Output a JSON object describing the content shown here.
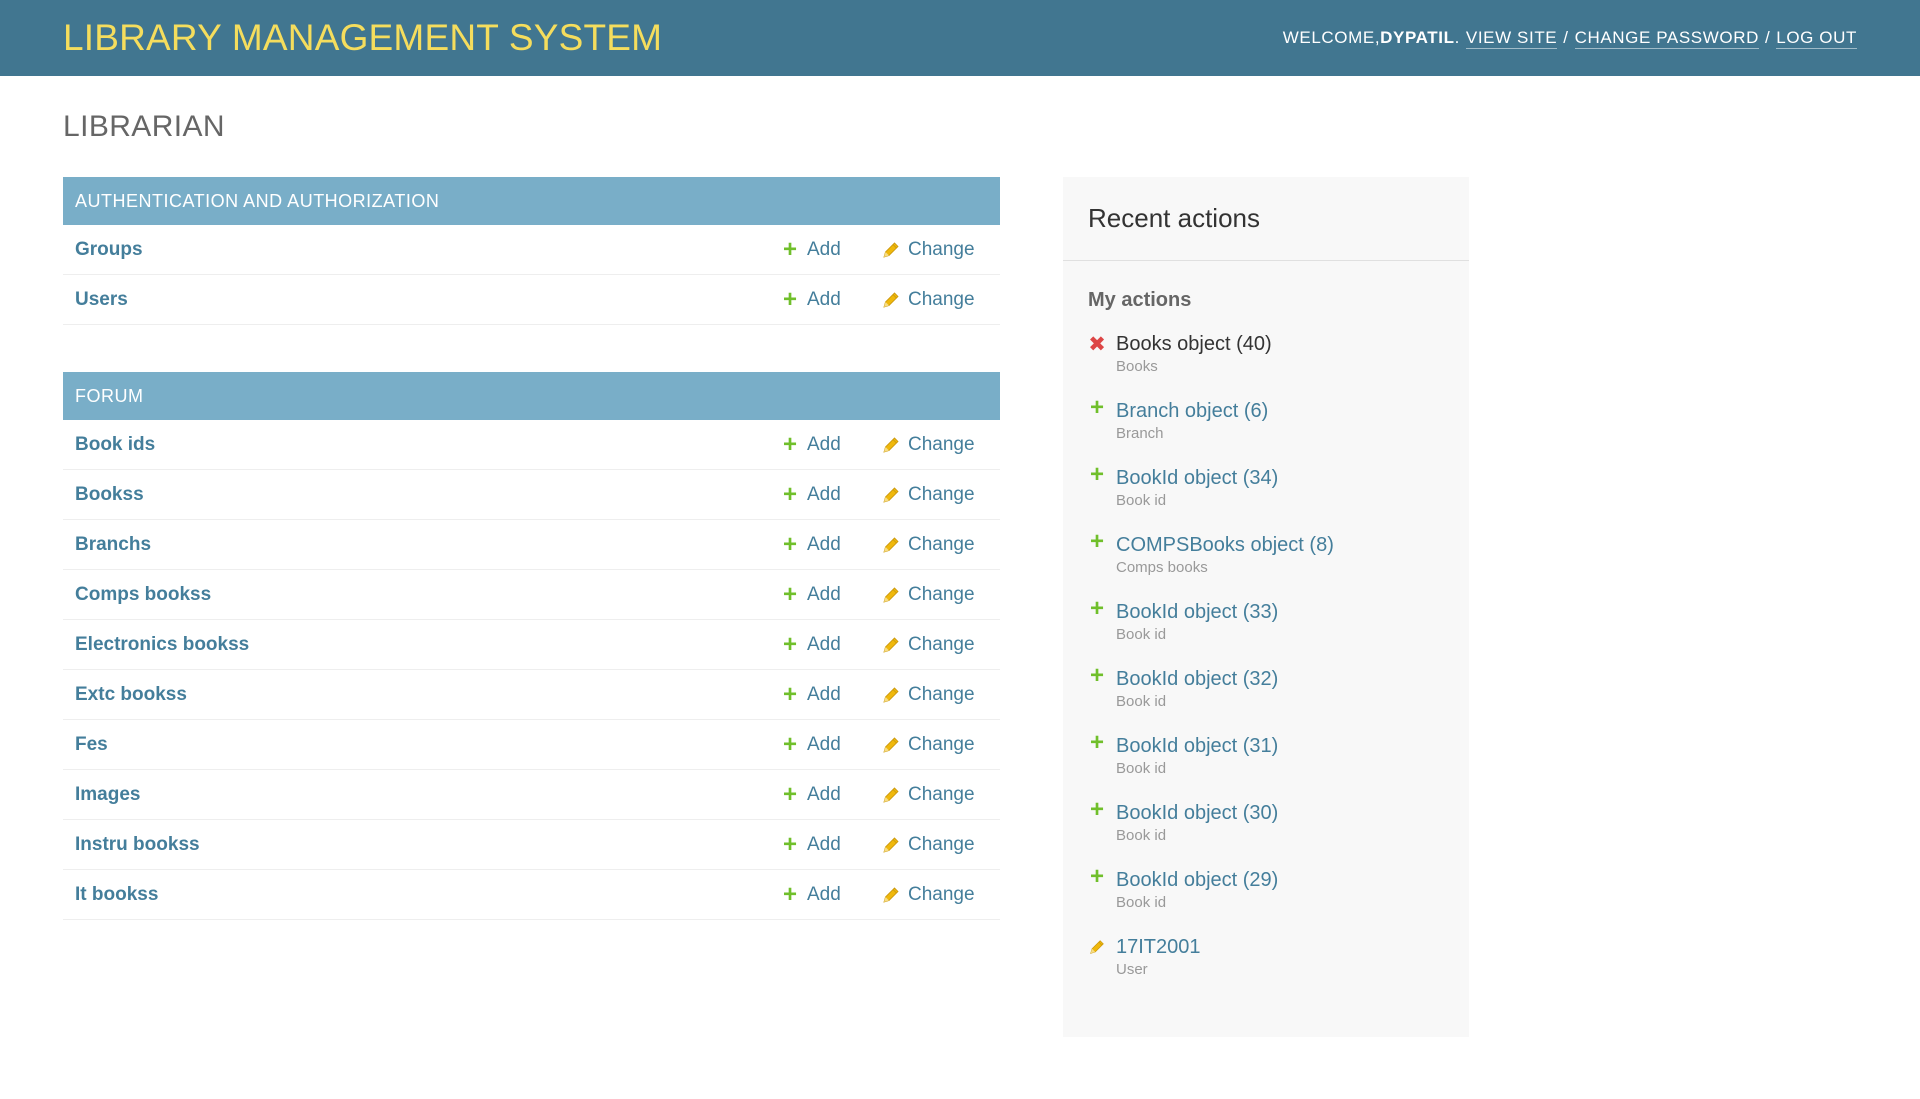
{
  "header": {
    "site_name": "LIBRARY MANAGEMENT SYSTEM",
    "welcome": "WELCOME, ",
    "username": "DYPATIL",
    "dot": ".",
    "view_site": "VIEW SITE",
    "change_password": "CHANGE PASSWORD",
    "log_out": "LOG OUT",
    "separator": "/"
  },
  "page_title": "LIBRARIAN",
  "labels": {
    "add": "Add",
    "change": "Change"
  },
  "modules": [
    {
      "caption": "AUTHENTICATION AND AUTHORIZATION",
      "models": [
        "Groups",
        "Users"
      ]
    },
    {
      "caption": "FORUM",
      "models": [
        "Book ids",
        "Bookss",
        "Branchs",
        "Comps bookss",
        "Electronics bookss",
        "Extc bookss",
        "Fes",
        "Images",
        "Instru bookss",
        "It bookss"
      ]
    }
  ],
  "recent_actions": {
    "title": "Recent actions",
    "subtitle": "My actions",
    "items": [
      {
        "title": "Books object (40)",
        "type": "Books",
        "action": "deletion"
      },
      {
        "title": "Branch object (6)",
        "type": "Branch",
        "action": "addition"
      },
      {
        "title": "BookId object (34)",
        "type": "Book id",
        "action": "addition"
      },
      {
        "title": "COMPSBooks object (8)",
        "type": "Comps books",
        "action": "addition"
      },
      {
        "title": "BookId object (33)",
        "type": "Book id",
        "action": "addition"
      },
      {
        "title": "BookId object (32)",
        "type": "Book id",
        "action": "addition"
      },
      {
        "title": "BookId object (31)",
        "type": "Book id",
        "action": "addition"
      },
      {
        "title": "BookId object (30)",
        "type": "Book id",
        "action": "addition"
      },
      {
        "title": "BookId object (29)",
        "type": "Book id",
        "action": "addition"
      },
      {
        "title": "17IT2001",
        "type": "User",
        "action": "change"
      }
    ]
  },
  "colors": {
    "header_bg": "#417690",
    "site_name": "#f5dd5d",
    "caption_bg": "#79aec8",
    "link": "#447e9b",
    "add_icon": "#70bf2b",
    "change_icon": "#efb80b",
    "delete_icon": "#dd4646"
  }
}
